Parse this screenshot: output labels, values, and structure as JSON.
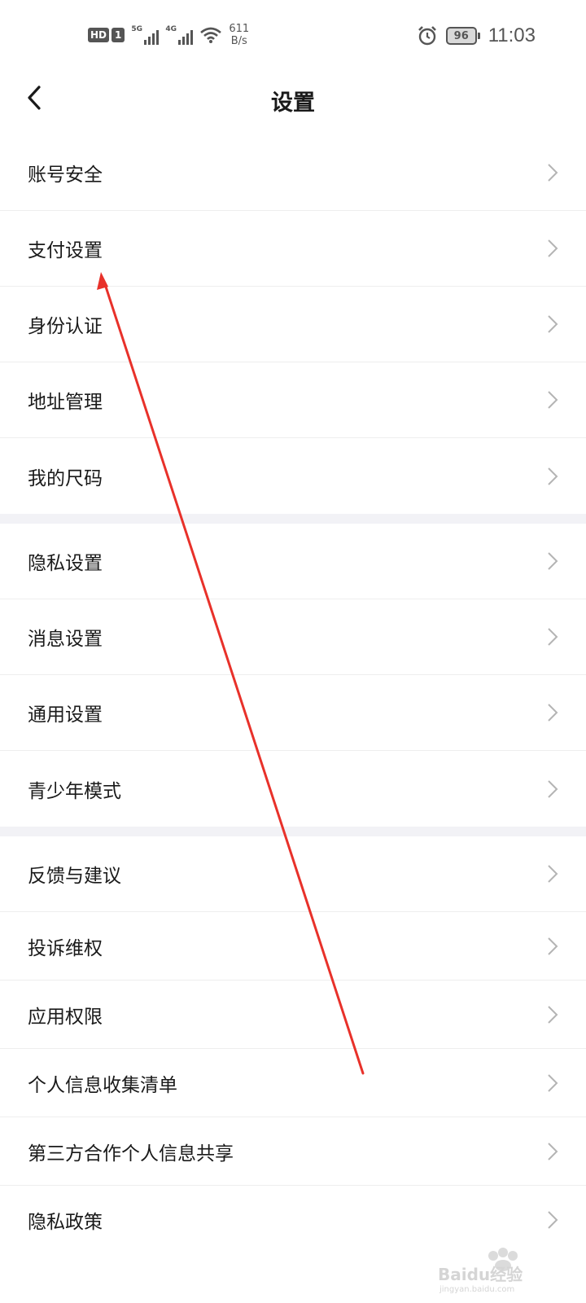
{
  "status_bar": {
    "hd": "HD",
    "sim": "1",
    "net1": "5G",
    "net2": "4G",
    "speed_value": "611",
    "speed_unit": "B/s",
    "battery": "96",
    "time": "11:03"
  },
  "header": {
    "title": "设置"
  },
  "groups": [
    {
      "items": [
        "账号安全",
        "支付设置",
        "身份认证",
        "地址管理",
        "我的尺码"
      ]
    },
    {
      "items": [
        "隐私设置",
        "消息设置",
        "通用设置",
        "青少年模式"
      ]
    },
    {
      "items": [
        "反馈与建议",
        "投诉维权",
        "应用权限",
        "个人信息收集清单",
        "第三方合作个人信息共享",
        "隐私政策"
      ]
    }
  ],
  "watermark": {
    "brand": "Baidu经验",
    "url": "jingyan.baidu.com"
  },
  "colors": {
    "annotation_arrow": "#e8312a",
    "separator": "#f2f2f6",
    "chevron": "#b4b4b4"
  }
}
